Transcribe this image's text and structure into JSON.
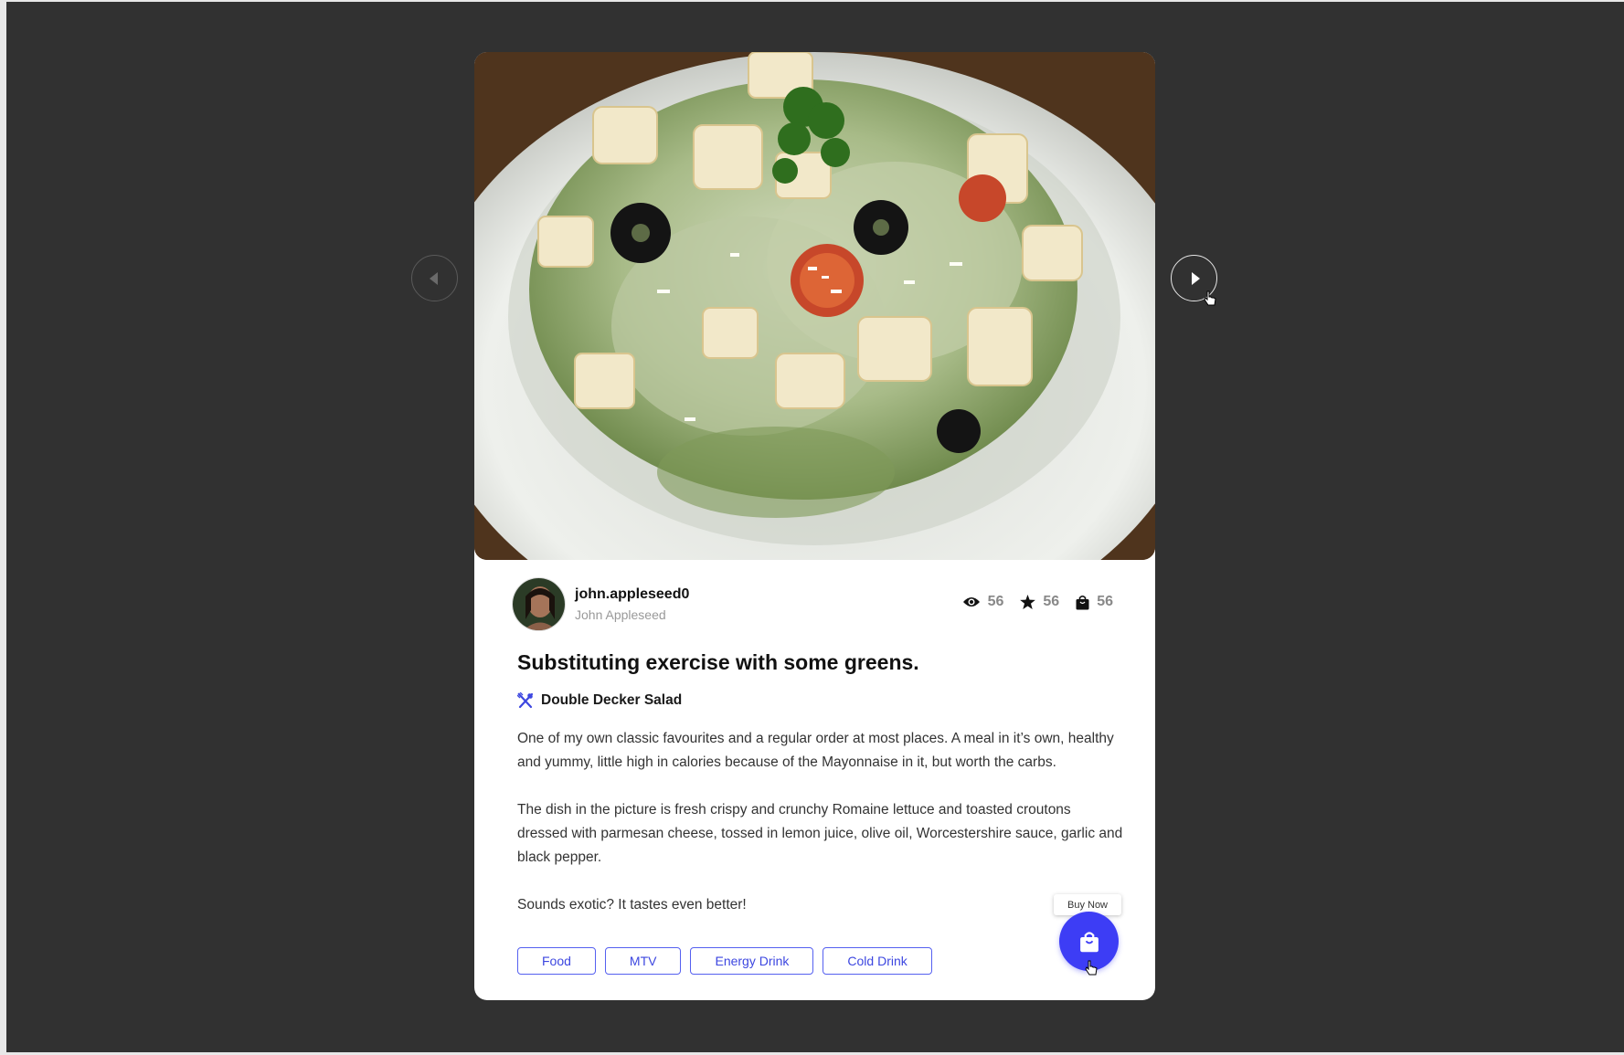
{
  "post": {
    "username": "john.appleseed0",
    "full_name": "John Appleseed",
    "stats": {
      "views": "56",
      "stars": "56",
      "purchases": "56"
    },
    "title": "Substituting exercise with some greens.",
    "dish_name": "Double Decker Salad",
    "paragraphs": [
      "One of my own classic favourites and a regular order at most places. A meal in it’s own, healthy and yummy, little high in calories because of the Mayonnaise in it, but worth the carbs.",
      "The dish in the picture is fresh crispy and crunchy Romaine lettuce and toasted croutons dressed with parmesan cheese, tossed in lemon juice, olive oil, Worcestershire sauce, garlic and black pepper.",
      "Sounds exotic? It tastes even better!"
    ],
    "tags": [
      "Food",
      "MTV",
      "Energy Drink",
      "Cold Drink"
    ],
    "buy_label": "Buy Now"
  },
  "icons": {
    "views": "eye-icon",
    "stars": "star-icon",
    "purchases": "shopping-bag-icon",
    "dish": "utensils-icon",
    "buy": "shopping-bag-icon",
    "prev": "chevron-left-icon",
    "next": "chevron-right-icon"
  },
  "colors": {
    "background": "#313131",
    "card": "#ffffff",
    "accent": "#3d3df5",
    "tag_border": "#5560f0"
  }
}
